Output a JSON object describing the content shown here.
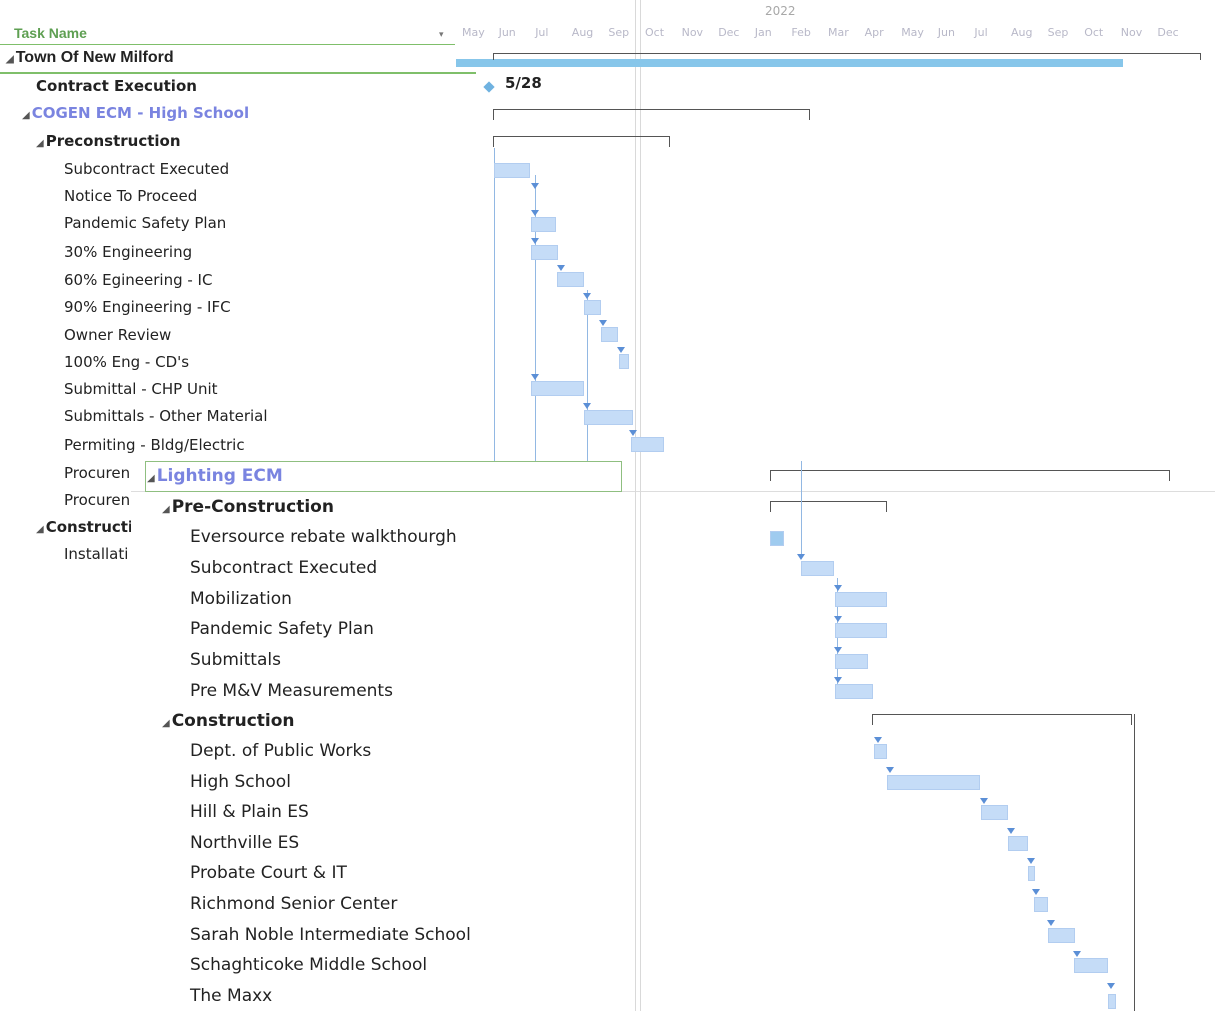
{
  "header": {
    "task_name_label": "Task Name",
    "dropdown_glyph": "▾",
    "year": "2022"
  },
  "timeline_months": [
    "May",
    "Jun",
    "Jul",
    "Aug",
    "Sep",
    "Oct",
    "Nov",
    "Dec",
    "Jan",
    "Feb",
    "Mar",
    "Apr",
    "May",
    "Jun",
    "Jul",
    "Aug",
    "Sep",
    "Oct",
    "Nov",
    "Dec"
  ],
  "collapse_glyph": "◢",
  "tasks": [
    {
      "name": "Town Of New Milford"
    },
    {
      "name": "Contract Execution"
    },
    {
      "name": "COGEN ECM - High School"
    },
    {
      "name": "Preconstruction"
    },
    {
      "name": "Subcontract Executed"
    },
    {
      "name": "Notice To Proceed"
    },
    {
      "name": "Pandemic Safety Plan"
    },
    {
      "name": "30% Engineering"
    },
    {
      "name": "60% Egineering - IC"
    },
    {
      "name": "90% Engineering - IFC"
    },
    {
      "name": "Owner Review"
    },
    {
      "name": "100% Eng - CD's"
    },
    {
      "name": "Submittal - CHP Unit"
    },
    {
      "name": "Submittals - Other Material"
    },
    {
      "name": "Permiting - Bldg/Electric"
    },
    {
      "name": "Procuren"
    },
    {
      "name": "Procuren"
    },
    {
      "name": "Constructi"
    },
    {
      "name": "Installati"
    }
  ],
  "milestone_label": "5/28",
  "overlay": {
    "title": "Lighting ECM",
    "preconstruction": "Pre-Construction",
    "construction": "Construction",
    "pre_tasks": [
      "Eversource rebate walkthourgh",
      "Subcontract Executed",
      "Mobilization",
      "Pandemic Safety Plan",
      "Submittals",
      "Pre M&V Measurements"
    ],
    "con_tasks": [
      "Dept. of Public Works",
      "High School",
      "Hill & Plain ES",
      "Northville ES",
      "Probate Court & IT",
      "Richmond Senior Center",
      "Sarah Noble Intermediate School",
      "Schaghticoke Middle School",
      "The Maxx"
    ]
  },
  "colors": {
    "bar": "#c5dcf7",
    "summary": "#87c6ea",
    "green": "#5e9f52",
    "blue_text": "#7a84e0"
  }
}
